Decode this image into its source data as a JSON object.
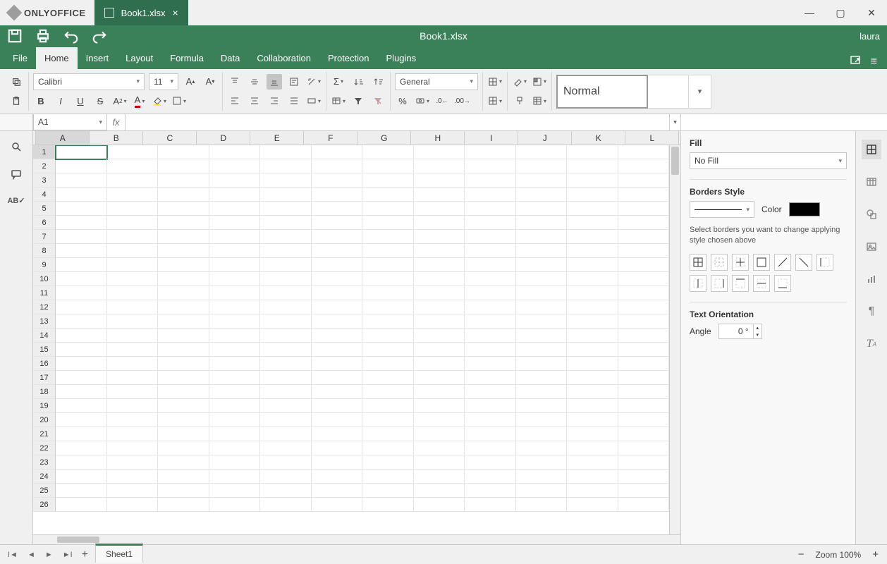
{
  "app": {
    "name": "ONLYOFFICE"
  },
  "tab": {
    "label": "Book1.xlsx"
  },
  "titlecenter": "Book1.xlsx",
  "user": "laura",
  "menu": {
    "file": "File",
    "home": "Home",
    "insert": "Insert",
    "layout": "Layout",
    "formula": "Formula",
    "data": "Data",
    "collaboration": "Collaboration",
    "protection": "Protection",
    "plugins": "Plugins"
  },
  "ribbon": {
    "font_name": "Calibri",
    "font_size": "11",
    "number_format": "General",
    "style_label": "Normal"
  },
  "namebox": "A1",
  "formula": "",
  "grid": {
    "columns": [
      "A",
      "B",
      "C",
      "D",
      "E",
      "F",
      "G",
      "H",
      "I",
      "J",
      "K",
      "L"
    ],
    "rows": [
      1,
      2,
      3,
      4,
      5,
      6,
      7,
      8,
      9,
      10,
      11,
      12,
      13,
      14,
      15,
      16,
      17,
      18,
      19,
      20,
      21,
      22,
      23,
      24,
      25,
      26
    ],
    "active": "A1"
  },
  "rightpanel": {
    "fill_label": "Fill",
    "fill_value": "No Fill",
    "borders_label": "Borders Style",
    "color_label": "Color",
    "hint": "Select borders you want to change applying style chosen above",
    "orient_label": "Text Orientation",
    "angle_label": "Angle",
    "angle_value": "0 °"
  },
  "status": {
    "sheet": "Sheet1",
    "zoom_label": "Zoom 100%"
  }
}
